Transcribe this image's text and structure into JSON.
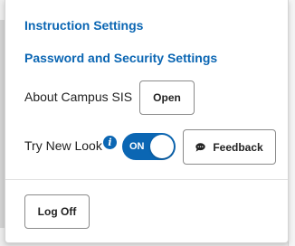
{
  "menu": {
    "links": {
      "instruction_settings": "Instruction Settings",
      "password_security_settings": "Password and Security Settings"
    },
    "about": {
      "label": "About Campus SIS",
      "button": "Open"
    },
    "new_look": {
      "label": "Try New Look",
      "info_icon": "i",
      "toggle_state": "ON",
      "feedback_button": "Feedback",
      "feedback_icon": "chat-bubble-icon"
    },
    "log_off_button": "Log Off"
  },
  "colors": {
    "link": "#0b66b3",
    "toggle_on": "#0b66b3",
    "text": "#222222",
    "button_border": "#8a8a8a"
  }
}
